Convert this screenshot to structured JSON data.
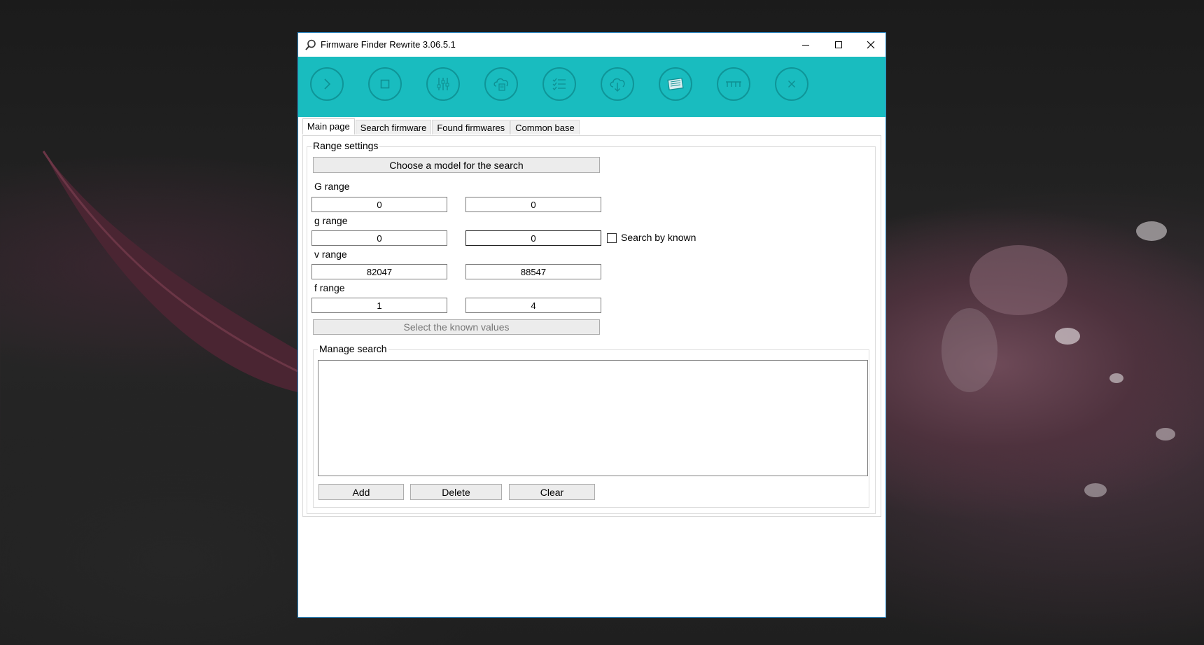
{
  "window": {
    "title": "Firmware Finder Rewrite 3.06.5.1"
  },
  "toolbar": [
    {
      "icon": "chevron-right-icon"
    },
    {
      "icon": "stop-icon"
    },
    {
      "icon": "settings-sliders-icon"
    },
    {
      "icon": "cloud-document-icon"
    },
    {
      "icon": "checklist-icon"
    },
    {
      "icon": "cloud-download-icon"
    },
    {
      "icon": "news-icon"
    },
    {
      "icon": "ruler-icon"
    },
    {
      "icon": "close-x-icon"
    }
  ],
  "tabs": [
    "Main page",
    "Search firmware",
    "Found firmwares",
    "Common base"
  ],
  "range_settings": {
    "label": "Range settings",
    "choose_model_button": "Choose a model for the search",
    "G": {
      "label": "G range",
      "from": "0",
      "to": "0"
    },
    "g": {
      "label": "g range",
      "from": "0",
      "to": "0"
    },
    "v": {
      "label": "v range",
      "from": "82047",
      "to": "88547"
    },
    "f": {
      "label": "f range",
      "from": "1",
      "to": "4"
    },
    "search_by_known": {
      "label": "Search by known",
      "checked": false
    },
    "select_known_button": "Select the known values"
  },
  "manage_search": {
    "label": "Manage search",
    "add_button": "Add",
    "delete_button": "Delete",
    "clear_button": "Clear"
  },
  "colors": {
    "toolbar": "#19bcbf",
    "window_border": "#2f8cc8"
  }
}
